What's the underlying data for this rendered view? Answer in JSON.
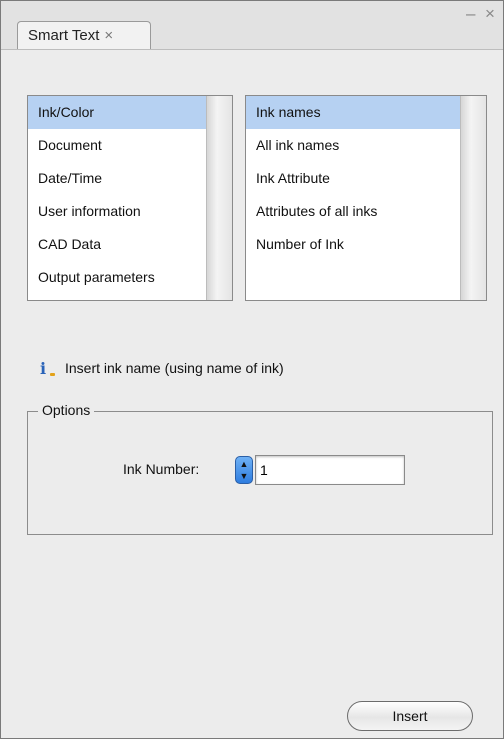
{
  "window": {
    "tab_title": "Smart Text",
    "tab_close": "×",
    "minimize_glyph": "–",
    "close_glyph": "×"
  },
  "categories": {
    "items": [
      {
        "label": "Ink/Color",
        "selected": true
      },
      {
        "label": "Document",
        "selected": false
      },
      {
        "label": "Date/Time",
        "selected": false
      },
      {
        "label": "User information",
        "selected": false
      },
      {
        "label": "CAD Data",
        "selected": false
      },
      {
        "label": "Output parameters",
        "selected": false
      }
    ]
  },
  "fields": {
    "items": [
      {
        "label": "Ink names",
        "selected": true
      },
      {
        "label": "All ink names",
        "selected": false
      },
      {
        "label": "Ink Attribute",
        "selected": false
      },
      {
        "label": "Attributes of all inks",
        "selected": false
      },
      {
        "label": "Number of Ink",
        "selected": false
      }
    ]
  },
  "info": {
    "icon": "info-icon",
    "text": "Insert ink name (using name of ink)"
  },
  "options": {
    "legend": "Options",
    "ink_number_label": "Ink Number:",
    "ink_number_value": "1"
  },
  "actions": {
    "insert_label": "Insert"
  },
  "colors": {
    "selection": "#b6d1f2",
    "panel_bg": "#ececec",
    "stepper_accent": "#3a86e6"
  }
}
